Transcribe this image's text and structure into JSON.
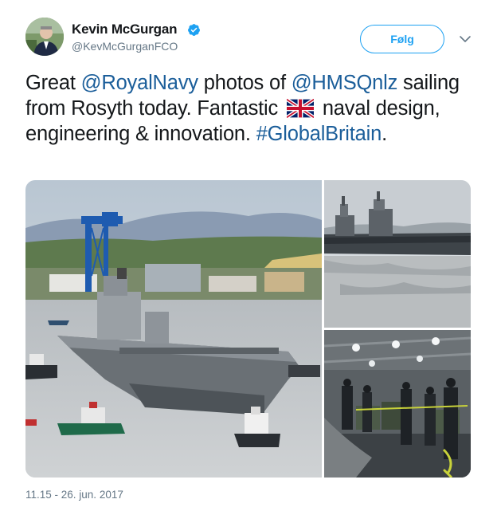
{
  "author": {
    "name": "Kevin McGurgan",
    "handle": "@KevMcGurganFCO",
    "verified_icon": "verified-badge-icon",
    "avatar_icon": "profile-avatar"
  },
  "actions": {
    "follow_label": "Følg",
    "more_icon": "chevron-down-icon"
  },
  "tweet": {
    "text_1": "Great ",
    "mention_1": "@RoyalNavy",
    "text_2": " photos of ",
    "mention_2": "@HMSQnlz",
    "text_3": " sailing from Rosyth today. Fantastic ",
    "emoji": "uk-flag-emoji",
    "text_4": " naval design, engineering & innovation. ",
    "hashtag": "#GlobalBritain",
    "text_5": "."
  },
  "media": {
    "photos": [
      "aircraft-carrier-leaving-dock-photo",
      "aircraft-carrier-on-water-photo",
      "crew-in-ship-hangar-photo"
    ]
  },
  "meta": {
    "timestamp": "11.15 - 26. jun. 2017"
  },
  "colors": {
    "link": "#1b5e9a",
    "accent": "#1da1f2",
    "secondary_text": "#657786"
  }
}
